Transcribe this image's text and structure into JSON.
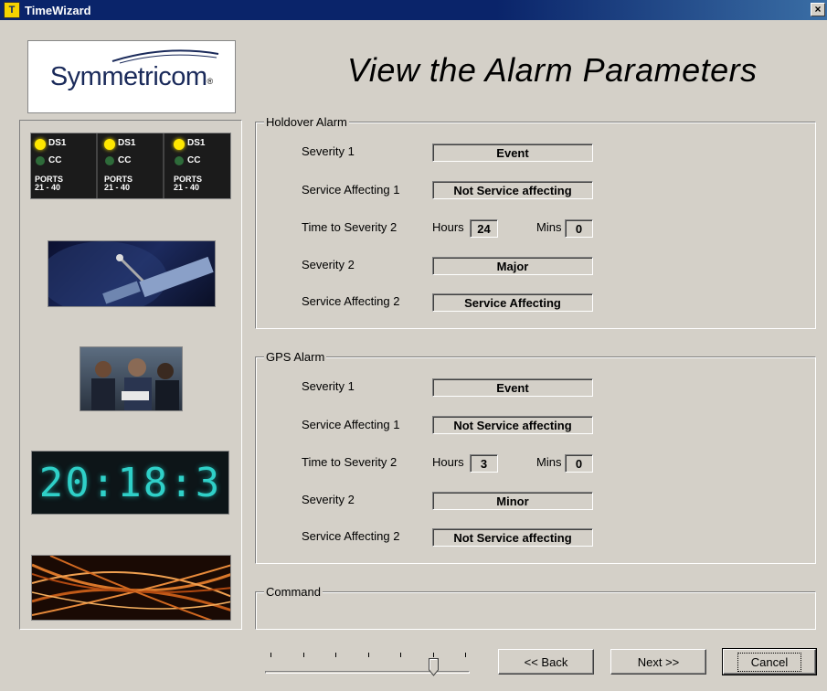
{
  "window": {
    "title": "TimeWizard",
    "close_glyph": "×"
  },
  "logo": {
    "text": "Symmetricom",
    "mark": "®"
  },
  "heading": "View the Alarm Parameters",
  "images": {
    "panel": {
      "leds": [
        "DS1",
        "CC"
      ],
      "ports": "PORTS",
      "port_range": "21 - 40"
    },
    "clock_digits": "20:18:3"
  },
  "labels": {
    "severity1": "Severity 1",
    "service1": "Service Affecting 1",
    "time_to_sev2": "Time to Severity 2",
    "hours": "Hours",
    "mins": "Mins",
    "severity2": "Severity 2",
    "service2": "Service Affecting 2"
  },
  "holdover": {
    "legend": "Holdover Alarm",
    "severity1": "Event",
    "service1": "Not Service affecting",
    "hours": "24",
    "mins": "0",
    "severity2": "Major",
    "service2": "Service Affecting"
  },
  "gps": {
    "legend": "GPS Alarm",
    "severity1": "Event",
    "service1": "Not Service affecting",
    "hours": "3",
    "mins": "0",
    "severity2": "Minor",
    "service2": "Not Service affecting"
  },
  "command": {
    "legend": "Command"
  },
  "wizard": {
    "step_count": 7,
    "current_step": 6
  },
  "buttons": {
    "back": "<< Back",
    "next": "Next >>",
    "cancel": "Cancel"
  }
}
